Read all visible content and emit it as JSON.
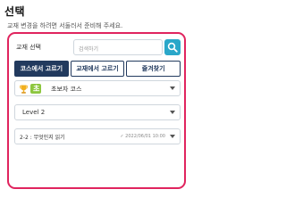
{
  "header": {
    "title": "선택",
    "subtitle": "교재 변경을 하려면 서둘러서 준비해 주세요."
  },
  "search": {
    "label": "교재 선택",
    "placeholder": "검색하기"
  },
  "tabs": [
    {
      "label": "코스에서 고르기",
      "active": true
    },
    {
      "label": "교재에서 고르기",
      "active": false
    },
    {
      "label": "즐겨찾기",
      "active": false
    }
  ],
  "course_select": {
    "badge": "초",
    "value": "초보자 코스"
  },
  "level_select": {
    "value": "Level 2"
  },
  "lesson_select": {
    "value": "2-2 : 무엇인지 읽기",
    "date": "✓ 2022/06/01 10:00"
  },
  "colors": {
    "accent_border": "#e0245e",
    "tab_active_bg": "#223a5e",
    "search_button": "#2aa7c9",
    "badge_green": "#8dc63f"
  },
  "icons": [
    "search-icon",
    "trophy-icon",
    "chevron-down-icon",
    "check-icon"
  ]
}
